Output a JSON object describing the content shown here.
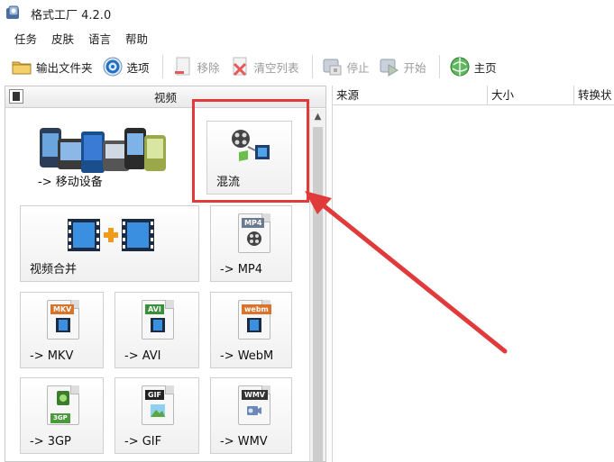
{
  "window": {
    "title": "格式工厂 4.2.0"
  },
  "menu": [
    "任务",
    "皮肤",
    "语言",
    "帮助"
  ],
  "toolbar": {
    "output_folder": "输出文件夹",
    "options": "选项",
    "remove": "移除",
    "clear_list": "清空列表",
    "stop": "停止",
    "start": "开始",
    "home": "主页"
  },
  "left_panel": {
    "header": "视频",
    "tiles": [
      {
        "id": "mobile",
        "label": "-> 移动设备",
        "icon": "mobile-devices-icon"
      },
      {
        "id": "mux",
        "label": "混流",
        "icon": "mux-icon"
      },
      {
        "id": "merge",
        "label": "视频合并",
        "icon": "video-merge-icon"
      },
      {
        "id": "mp4",
        "label": "-> MP4",
        "icon": "mp4-file-icon",
        "tag": "MP4"
      },
      {
        "id": "mkv",
        "label": "-> MKV",
        "icon": "mkv-file-icon",
        "tag": "MKV"
      },
      {
        "id": "avi",
        "label": "-> AVI",
        "icon": "avi-file-icon",
        "tag": "AVI"
      },
      {
        "id": "webm",
        "label": "-> WebM",
        "icon": "webm-file-icon",
        "tag": "webm"
      },
      {
        "id": "3gp",
        "label": "-> 3GP",
        "icon": "3gp-file-icon",
        "tag": "3GP"
      },
      {
        "id": "gif",
        "label": "-> GIF",
        "icon": "gif-file-icon",
        "tag": "GIF"
      },
      {
        "id": "wmv",
        "label": "-> WMV",
        "icon": "wmv-file-icon",
        "tag": "WMV"
      }
    ]
  },
  "right_panel": {
    "columns": [
      "来源",
      "大小",
      "转换状"
    ]
  },
  "colors": {
    "highlight": "#e03a3a",
    "accent_blue": "#1f6fc5",
    "film_blue": "#3a7bd5"
  }
}
